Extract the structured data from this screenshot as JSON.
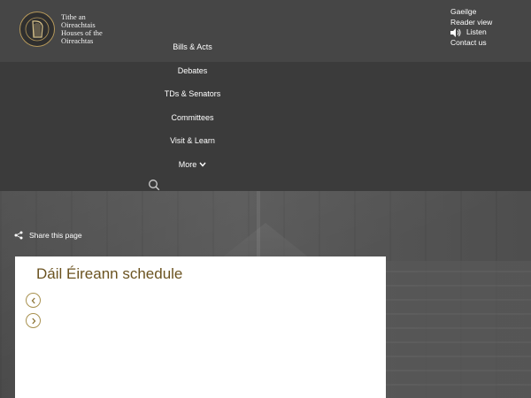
{
  "logo": {
    "icon": "harp-icon",
    "lines": [
      "Tithe an",
      "Oireachtais",
      "Houses of the",
      "Oireachtas"
    ]
  },
  "utility": {
    "gaeilge": "Gaeilge",
    "reader_view": "Reader view",
    "listen": "Listen",
    "contact": "Contact us"
  },
  "nav": {
    "items": [
      "Bills & Acts",
      "Debates",
      "TDs & Senators",
      "Committees",
      "Visit & Learn",
      "More"
    ]
  },
  "share": {
    "label": "Share this page",
    "icon": "share-icon"
  },
  "schedule": {
    "title": "Dáil Éireann schedule"
  },
  "colors": {
    "accent_gold": "#a8914f",
    "title_brown": "#6b5320",
    "header_bg": "#3a3a3a"
  }
}
